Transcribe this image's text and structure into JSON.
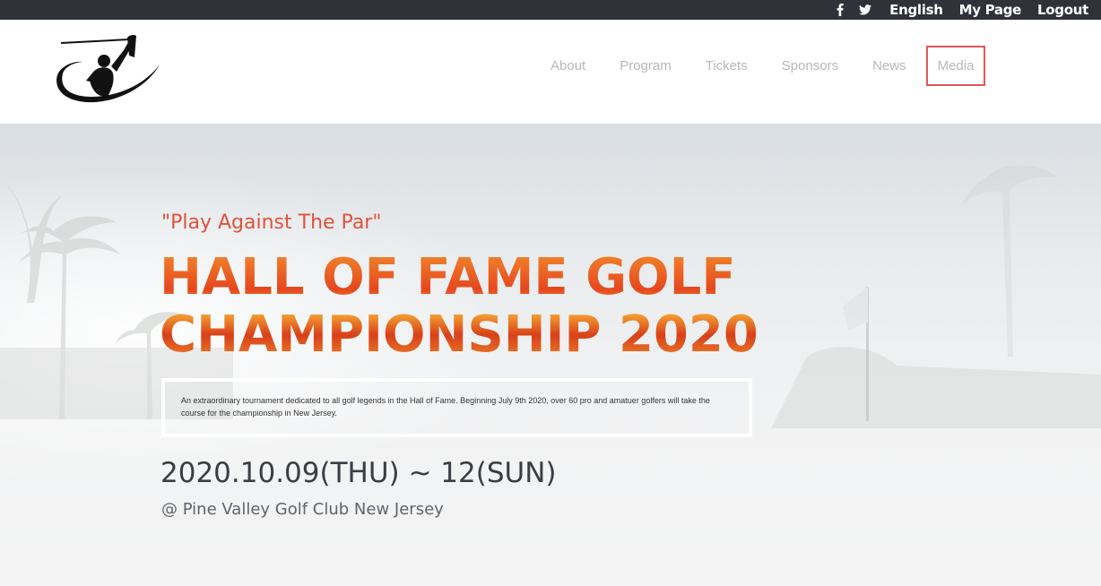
{
  "topbar": {
    "social_icons": [
      "facebook-icon",
      "twitter-icon"
    ],
    "links": {
      "language": "English",
      "my_page": "My Page",
      "logout": "Logout"
    }
  },
  "nav": {
    "items": [
      "About",
      "Program",
      "Tickets",
      "Sponsors",
      "News",
      "Media"
    ],
    "highlight_color": "#e15757"
  },
  "hero": {
    "tagline": "\"Play Against The Par\"",
    "title_line1": "HALL OF FAME GOLF",
    "title_line2": "CHAMPIONSHIP 2020",
    "description": "An extraordinary tournament dedicated to all golf legends in the Hall of Fame. Beginning July 9th 2020, over 60 pro and amatuer golfers will take the course for the championship in New Jersey.",
    "date": "2020.10.09(THU) ~ 12(SUN)",
    "venue": "@ Pine Valley Golf Club New Jersey"
  },
  "colors": {
    "topbar_bg": "#2f3239",
    "accent_red": "#e3513c",
    "nav_text": "#b8b8b8"
  }
}
